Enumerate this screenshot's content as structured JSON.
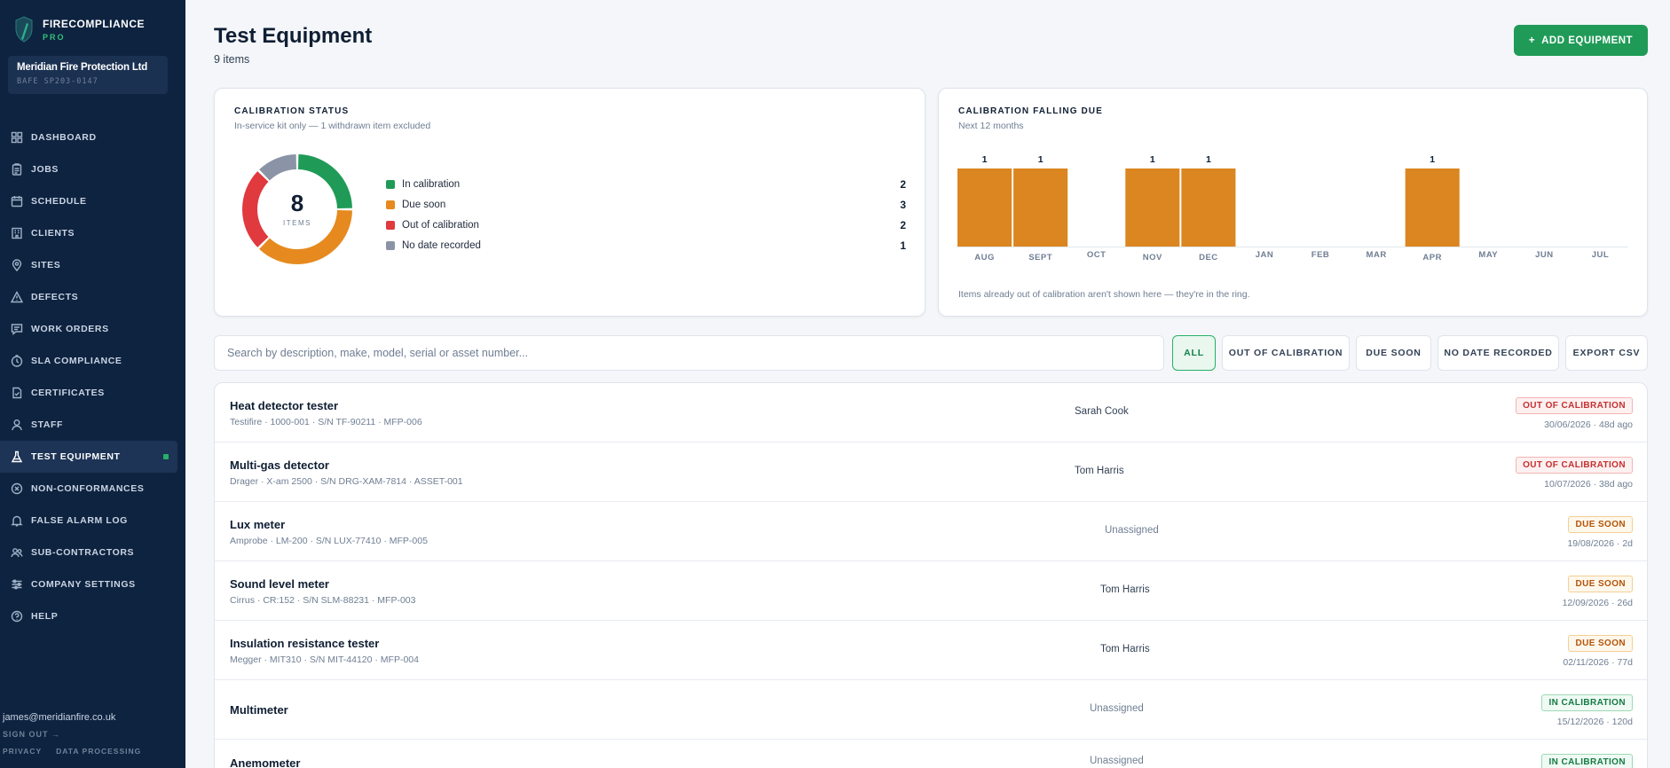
{
  "brand": {
    "name": "FIRECOMPLIANCE",
    "sub": "PRO"
  },
  "company": {
    "name": "Meridian Fire Protection Ltd",
    "id": "BAFE SP203-0147"
  },
  "nav": [
    {
      "label": "DASHBOARD",
      "icon": "grid-icon"
    },
    {
      "label": "JOBS",
      "icon": "clipboard-icon"
    },
    {
      "label": "SCHEDULE",
      "icon": "calendar-icon"
    },
    {
      "label": "CLIENTS",
      "icon": "building-icon"
    },
    {
      "label": "SITES",
      "icon": "map-pin-icon"
    },
    {
      "label": "DEFECTS",
      "icon": "warning-icon"
    },
    {
      "label": "WORK ORDERS",
      "icon": "message-icon"
    },
    {
      "label": "SLA COMPLIANCE",
      "icon": "clock-icon"
    },
    {
      "label": "CERTIFICATES",
      "icon": "document-check-icon"
    },
    {
      "label": "STAFF",
      "icon": "user-icon"
    },
    {
      "label": "TEST EQUIPMENT",
      "icon": "flask-icon",
      "active": true
    },
    {
      "label": "NON-CONFORMANCES",
      "icon": "x-circle-icon"
    },
    {
      "label": "FALSE ALARM LOG",
      "icon": "bell-icon"
    },
    {
      "label": "SUB-CONTRACTORS",
      "icon": "users-icon"
    },
    {
      "label": "COMPANY SETTINGS",
      "icon": "sliders-icon"
    },
    {
      "label": "HELP",
      "icon": "help-circle-icon"
    }
  ],
  "footer": {
    "email": "james@meridianfire.co.uk",
    "signout": "SIGN OUT →",
    "privacy": "PRIVACY",
    "data_processing": "DATA PROCESSING"
  },
  "page": {
    "title": "Test Equipment",
    "count": "9 items",
    "add_button": "ADD EQUIPMENT",
    "add_icon": "+"
  },
  "calibration_status": {
    "title": "CALIBRATION STATUS",
    "subtitle": "In-service kit only — 1 withdrawn item excluded",
    "total": "8",
    "total_label": "ITEMS",
    "segments": [
      {
        "label": "In calibration",
        "value": 2,
        "color": "#1f9b57"
      },
      {
        "label": "Due soon",
        "value": 3,
        "color": "#e68a1f"
      },
      {
        "label": "Out of calibration",
        "value": 2,
        "color": "#e0393e"
      },
      {
        "label": "No date recorded",
        "value": 1,
        "color": "#8b94a6"
      }
    ]
  },
  "falling_due": {
    "title": "CALIBRATION FALLING DUE",
    "subtitle": "Next 12 months",
    "note": "Items already out of calibration aren't shown here — they're in the ring.",
    "bar_color": "#db8620"
  },
  "chart_data": {
    "type": "bar",
    "categories": [
      "AUG",
      "SEPT",
      "OCT",
      "NOV",
      "DEC",
      "JAN",
      "FEB",
      "MAR",
      "APR",
      "MAY",
      "JUN",
      "JUL"
    ],
    "values": [
      1,
      1,
      0,
      1,
      1,
      0,
      0,
      0,
      1,
      0,
      0,
      0
    ],
    "data_labels": [
      "1",
      "1",
      "",
      "1",
      "1",
      "",
      "",
      "",
      "1",
      "",
      "",
      ""
    ],
    "title": "CALIBRATION FALLING DUE",
    "subtitle": "Next 12 months",
    "ylim": [
      0,
      1
    ],
    "grid": false
  },
  "filters": {
    "search_placeholder": "Search by description, make, model, serial or asset number...",
    "all": "ALL",
    "out": "OUT OF CALIBRATION",
    "due": "DUE SOON",
    "nodate": "NO DATE RECORDED",
    "export": "EXPORT CSV"
  },
  "equipment": [
    {
      "name": "Heat detector tester",
      "meta": "Testifire · 1000-001 · S/N TF-90211 · MFP-006",
      "assignee": "Sarah Cook",
      "status": "OUT OF CALIBRATION",
      "status_type": "out",
      "date": "30/06/2026 · 48d ago"
    },
    {
      "name": "Multi-gas detector",
      "meta": "Drager · X-am 2500 · S/N DRG-XAM-7814 · ASSET-001",
      "assignee": "Tom Harris",
      "status": "OUT OF CALIBRATION",
      "status_type": "out",
      "date": "10/07/2026 · 38d ago"
    },
    {
      "name": "Lux meter",
      "meta": "Amprobe · LM-200 · S/N LUX-77410 · MFP-005",
      "assignee": "Unassigned",
      "status": "DUE SOON",
      "status_type": "due",
      "date": "19/08/2026 · 2d"
    },
    {
      "name": "Sound level meter",
      "meta": "Cirrus · CR:152 · S/N SLM-88231 · MFP-003",
      "assignee": "Tom Harris",
      "status": "DUE SOON",
      "status_type": "due",
      "date": "12/09/2026 · 26d"
    },
    {
      "name": "Insulation resistance tester",
      "meta": "Megger · MIT310 · S/N MIT-44120 · MFP-004",
      "assignee": "Tom Harris",
      "status": "DUE SOON",
      "status_type": "due",
      "date": "02/11/2026 · 77d"
    },
    {
      "name": "Multimeter",
      "meta": "",
      "assignee": "Unassigned",
      "status": "IN CALIBRATION",
      "status_type": "in",
      "date": "15/12/2026 · 120d"
    },
    {
      "name": "Anemometer",
      "meta": "",
      "assignee": "Unassigned",
      "status": "IN CALIBRATION",
      "status_type": "in",
      "date": ""
    }
  ]
}
